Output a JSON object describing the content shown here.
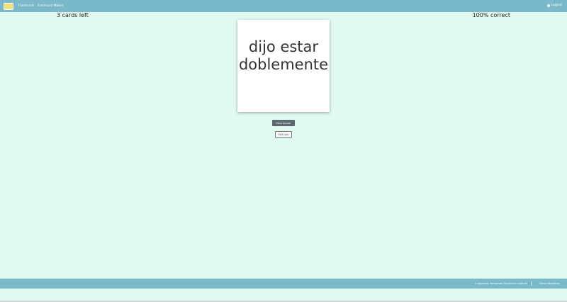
{
  "navbar": {
    "links": [
      {
        "label": "Flashcard"
      },
      {
        "label": "Flashcard Maker"
      }
    ],
    "logout_label": "Logout"
  },
  "stats": {
    "cards_left": "3 cards left",
    "correct": "100% correct"
  },
  "card": {
    "line1": "dijo estar",
    "line2": "doblemente"
  },
  "buttons": {
    "show_answer": "Show Answer",
    "edit_card": "Edit Card"
  },
  "footer": {
    "institution": "Linguacard, Rensselaer Polytechnic Institute",
    "link": "Github Repository"
  },
  "colors": {
    "navbar": "#79b9c9",
    "background": "#e0faf2",
    "show_button": "#5c6a6e"
  }
}
